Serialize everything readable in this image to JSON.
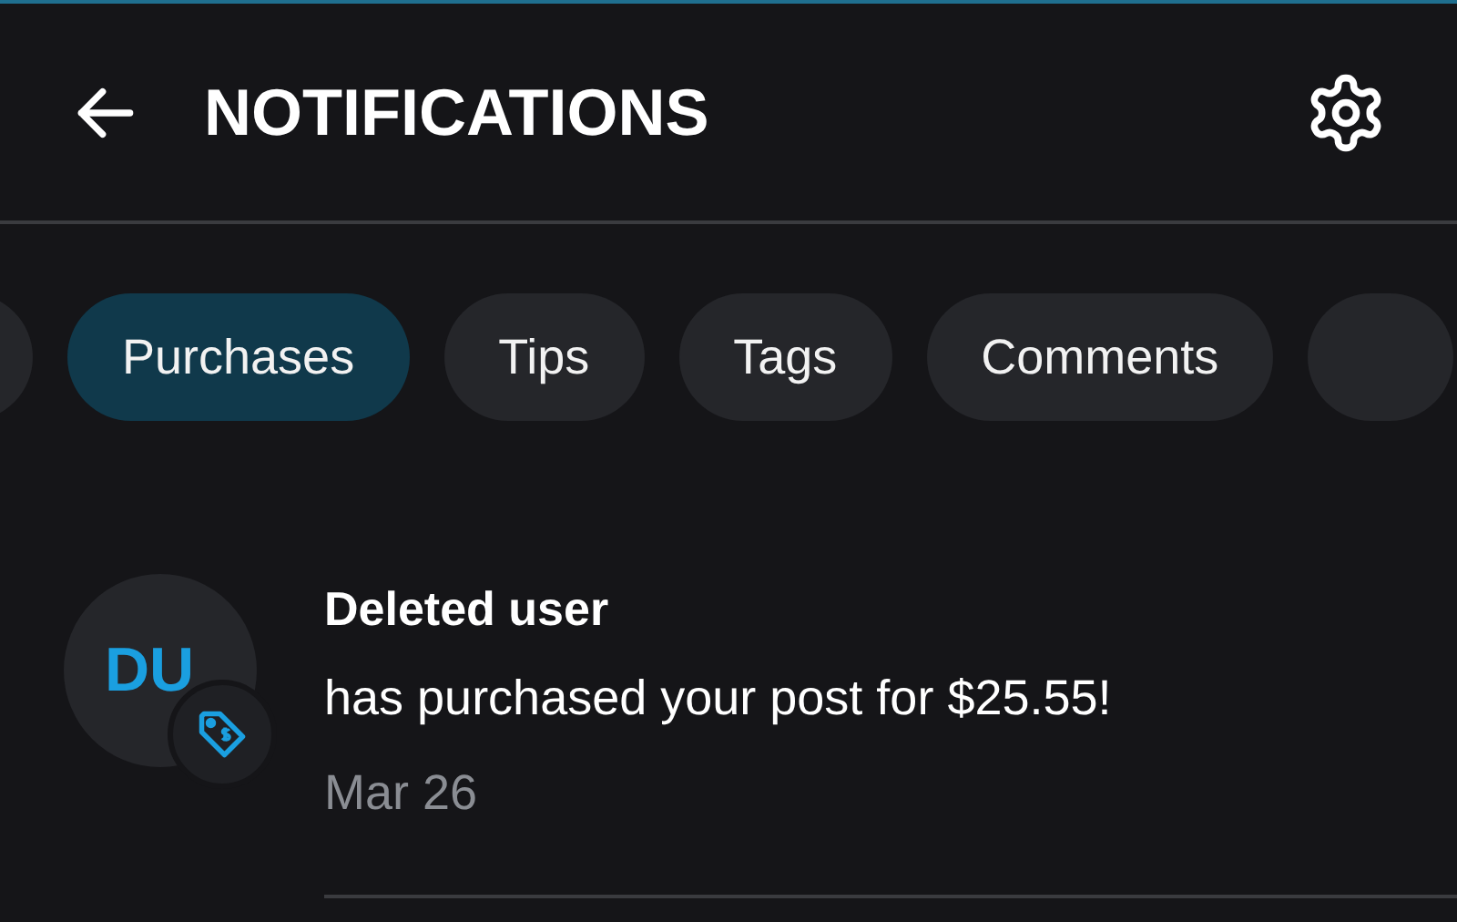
{
  "header": {
    "title": "NOTIFICATIONS"
  },
  "tabs": [
    {
      "label": "Purchases",
      "selected": true
    },
    {
      "label": "Tips",
      "selected": false
    },
    {
      "label": "Tags",
      "selected": false
    },
    {
      "label": "Comments",
      "selected": false
    }
  ],
  "notifications": [
    {
      "initials": "DU",
      "name": "Deleted user",
      "message": "has purchased your post for $25.55!",
      "date": "Mar 26",
      "kind": "purchase"
    }
  ]
}
